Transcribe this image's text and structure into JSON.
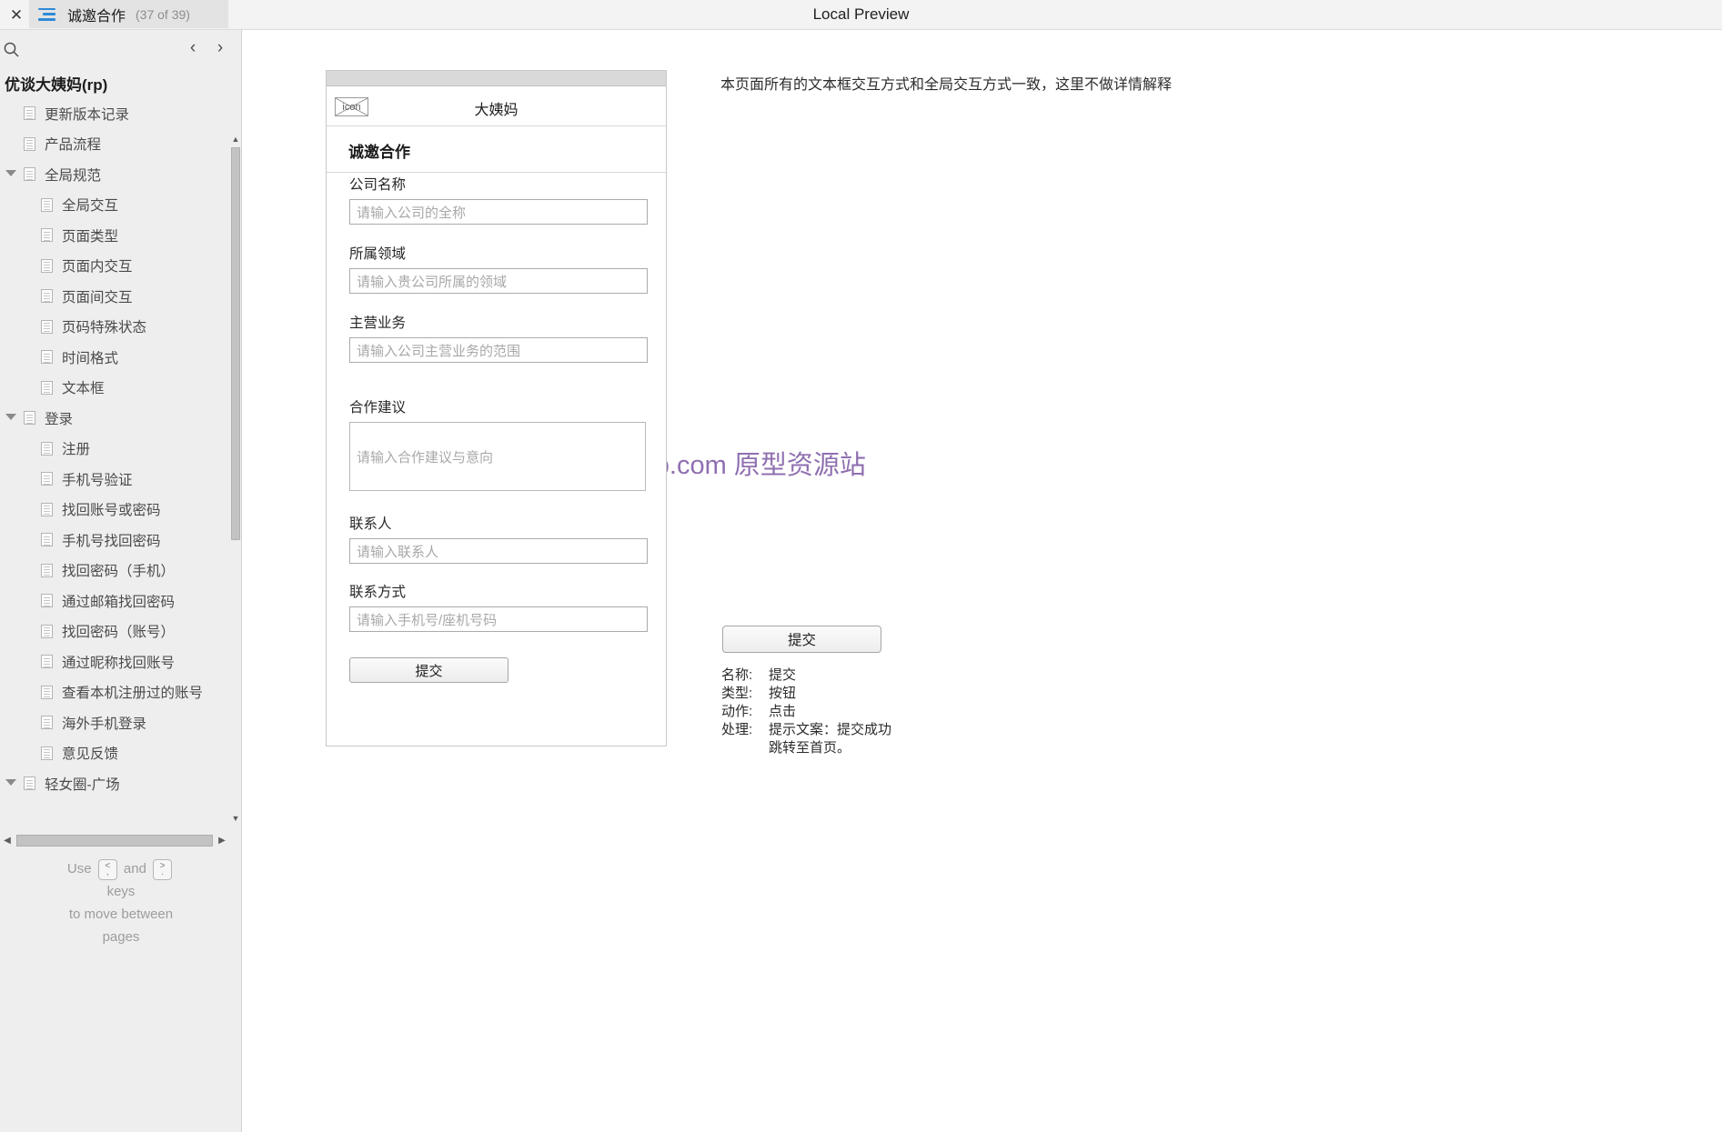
{
  "topbar": {
    "close_label": "✕",
    "tab_title": "诚邀合作",
    "tab_count": "(37 of 39)",
    "window_title": "Local Preview",
    "menu_icon": "hamburger-icon"
  },
  "sidebar": {
    "search_icon": "search-icon",
    "prev_label": "‹",
    "next_label": "›",
    "project_title": "优谈大姨妈(rp)",
    "tree": [
      {
        "label": "更新版本记录",
        "depth": 1,
        "expandable": false
      },
      {
        "label": "产品流程",
        "depth": 1,
        "expandable": false
      },
      {
        "label": "全局规范",
        "depth": 1,
        "expandable": true
      },
      {
        "label": "全局交互",
        "depth": 2,
        "expandable": false
      },
      {
        "label": "页面类型",
        "depth": 2,
        "expandable": false
      },
      {
        "label": "页面内交互",
        "depth": 2,
        "expandable": false
      },
      {
        "label": "页面间交互",
        "depth": 2,
        "expandable": false
      },
      {
        "label": "页码特殊状态",
        "depth": 2,
        "expandable": false
      },
      {
        "label": "时间格式",
        "depth": 2,
        "expandable": false
      },
      {
        "label": "文本框",
        "depth": 2,
        "expandable": false
      },
      {
        "label": "登录",
        "depth": 1,
        "expandable": true
      },
      {
        "label": "注册",
        "depth": 2,
        "expandable": false
      },
      {
        "label": "手机号验证",
        "depth": 2,
        "expandable": false
      },
      {
        "label": "找回账号或密码",
        "depth": 2,
        "expandable": false
      },
      {
        "label": "手机号找回密码",
        "depth": 2,
        "expandable": false
      },
      {
        "label": "找回密码（手机）",
        "depth": 2,
        "expandable": false
      },
      {
        "label": "通过邮箱找回密码",
        "depth": 2,
        "expandable": false
      },
      {
        "label": "找回密码（账号）",
        "depth": 2,
        "expandable": false
      },
      {
        "label": "通过昵称找回账号",
        "depth": 2,
        "expandable": false
      },
      {
        "label": "查看本机注册过的账号",
        "depth": 2,
        "expandable": false
      },
      {
        "label": "海外手机登录",
        "depth": 2,
        "expandable": false
      },
      {
        "label": "意见反馈",
        "depth": 2,
        "expandable": false
      },
      {
        "label": "轻女圈-广场",
        "depth": 1,
        "expandable": true
      }
    ],
    "hscroll_left": "◀",
    "hscroll_right": "▶",
    "vscroll_up": "▲",
    "vscroll_down": "▼",
    "hint": {
      "use": "Use",
      "and": "and",
      "key_prev_top": "<",
      "key_prev_bot": ",",
      "key_next_top": ">",
      "key_next_bot": ".",
      "line2": "keys",
      "line3": "to move between",
      "line4": "pages"
    }
  },
  "canvas": {
    "note_top": "本页面所有的文本框交互方式和全局交互方式一致，这里不做详情解释",
    "watermark": "axurehub.com 原型资源站"
  },
  "phone": {
    "app_icon_label": "icon",
    "app_name": "大姨妈",
    "page_title": "诚邀合作",
    "fields": [
      {
        "label": "公司名称",
        "placeholder": "请输入公司的全称",
        "type": "input"
      },
      {
        "label": "所属领域",
        "placeholder": "请输入贵公司所属的领域",
        "type": "input"
      },
      {
        "label": "主营业务",
        "placeholder": "请输入公司主营业务的范围",
        "type": "input"
      },
      {
        "label": "合作建议",
        "placeholder": "请输入合作建议与意向",
        "type": "textarea"
      },
      {
        "label": "联系人",
        "placeholder": "请输入联系人",
        "type": "input"
      },
      {
        "label": "联系方式",
        "placeholder": "请输入手机号/座机号码",
        "type": "input"
      }
    ],
    "submit_label": "提交"
  },
  "annotation": {
    "button_label": "提交",
    "rows": [
      {
        "key": "名称:",
        "value": "提交"
      },
      {
        "key": "类型:",
        "value": "按钮"
      },
      {
        "key": "动作:",
        "value": "点击"
      },
      {
        "key": "处理:",
        "value": "提示文案：提交成功\n跳转至首页。"
      }
    ]
  }
}
